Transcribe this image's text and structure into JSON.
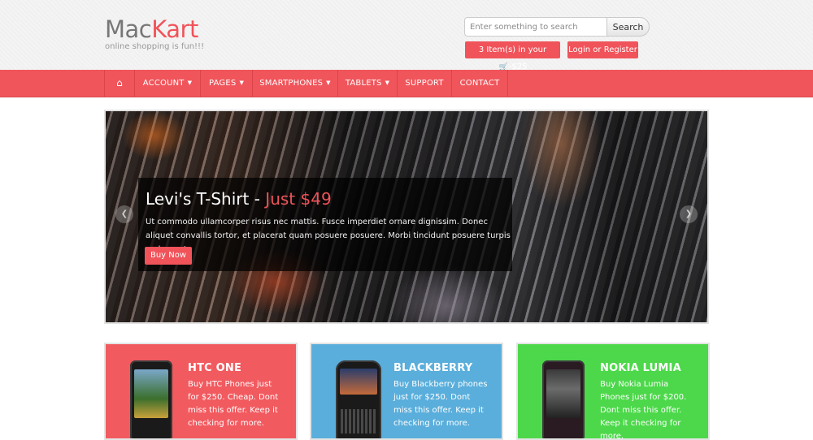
{
  "brand": {
    "name_part1": "Mac",
    "name_part2": "Kart",
    "tagline": "online shopping is fun!!!"
  },
  "search": {
    "placeholder": "Enter something to search",
    "button_label": "Search"
  },
  "cart": {
    "label_prefix": "3 Item(s) in your",
    "icon": "cart-icon",
    "label_suffix": "-$25"
  },
  "login": {
    "label": "Login or Register"
  },
  "nav": {
    "home_icon": "home-icon",
    "items": [
      {
        "label": "ACCOUNT",
        "dropdown": true
      },
      {
        "label": "PAGES",
        "dropdown": true
      },
      {
        "label": "SMARTPHONES",
        "dropdown": true
      },
      {
        "label": "TABLETS",
        "dropdown": true
      },
      {
        "label": "SUPPORT",
        "dropdown": false
      },
      {
        "label": "CONTACT",
        "dropdown": false
      }
    ]
  },
  "slider": {
    "title": "Levi's T-Shirt - ",
    "title_price": "Just $49",
    "text": "Ut commodo ullamcorper risus nec mattis. Fusce imperdiet ornare dignissim. Donec aliquet convallis tortor, et placerat quam posuere posuere. Morbi tincidunt posuere turpis eu laoreet.",
    "button_label": "Buy Now",
    "prev_icon": "chevron-left-icon",
    "next_icon": "chevron-right-icon"
  },
  "products": [
    {
      "title": "HTC ONE",
      "desc": "Buy HTC Phones just for $250. Cheap. Dont miss this offer. Keep it checking for more.",
      "color": "#f15a5f"
    },
    {
      "title": "BLACKBERRY",
      "desc": "Buy Blackberry phones just for $250. Dont miss this offer. Keep it checking for more.",
      "color": "#5aaedb"
    },
    {
      "title": "NOKIA LUMIA",
      "desc": "Buy Nokia Lumia Phones just for $200. Dont miss this offer. Keep it checking for more.",
      "color": "#4cd84a"
    }
  ],
  "colors": {
    "accent": "#f0535a",
    "nav_bg": "#f0555b"
  }
}
